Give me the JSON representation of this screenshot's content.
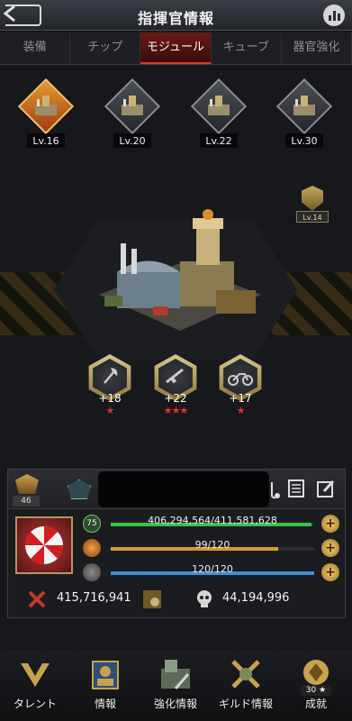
{
  "header": {
    "title": "指揮官情報"
  },
  "tabs": [
    {
      "label": "装備",
      "active": false
    },
    {
      "label": "チップ",
      "active": false
    },
    {
      "label": "モジュール",
      "active": true
    },
    {
      "label": "キューブ",
      "active": false
    },
    {
      "label": "器官強化",
      "active": false
    }
  ],
  "modules": [
    {
      "level": "Lv.16",
      "selected": true
    },
    {
      "level": "Lv.20",
      "selected": false
    },
    {
      "level": "Lv.22",
      "selected": false
    },
    {
      "level": "Lv.30",
      "selected": false
    }
  ],
  "side_badge": {
    "level": "Lv.14"
  },
  "bonuses": [
    {
      "icon": "axe-icon",
      "value": "+18",
      "stars": "★"
    },
    {
      "icon": "rifle-icon",
      "value": "+22",
      "stars": "★★★"
    },
    {
      "icon": "motorcycle-icon",
      "value": "+17",
      "stars": "★"
    }
  ],
  "panel": {
    "rank_number": "46",
    "stats": {
      "hp": {
        "text": "406,294,564/411,581,628",
        "fraction": 0.987,
        "color": "#37c24a",
        "badge": "75"
      },
      "stamina": {
        "text": "99/120",
        "fraction": 0.825,
        "color": "#d79a2d"
      },
      "energy": {
        "text": "120/120",
        "fraction": 1.0,
        "color": "#3a8fd6"
      }
    },
    "power": "415,716,941",
    "kills": "44,194,996"
  },
  "nav": [
    {
      "label": "タレント",
      "icon": "talent-icon"
    },
    {
      "label": "情報",
      "icon": "info-icon"
    },
    {
      "label": "強化情報",
      "icon": "upgrade-icon"
    },
    {
      "label": "ギルド情報",
      "icon": "guild-icon"
    },
    {
      "label": "成就",
      "icon": "achievement-icon",
      "count": "30 ★"
    }
  ]
}
